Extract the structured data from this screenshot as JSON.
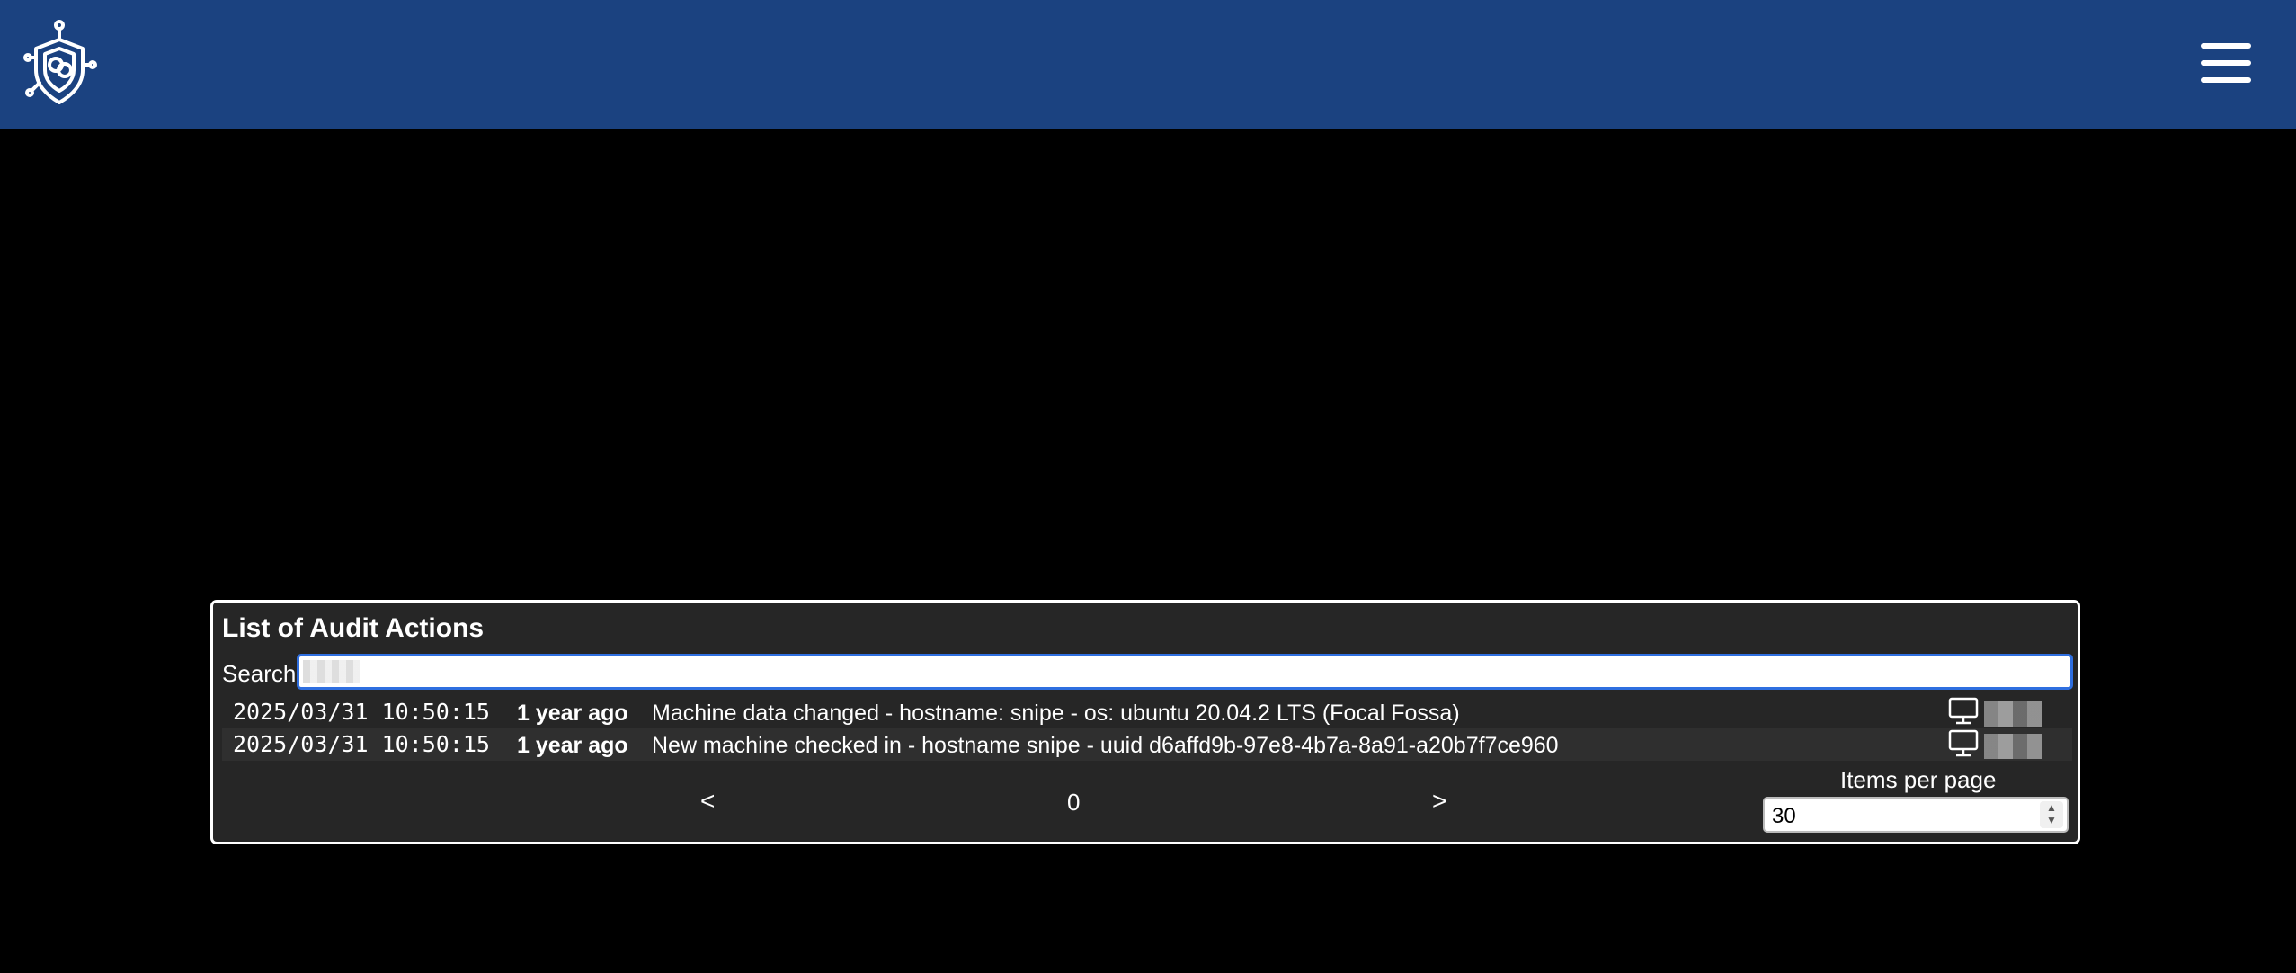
{
  "header": {
    "logo_icon": "shield-circuit-logo",
    "menu_icon": "hamburger-menu-icon",
    "background": "#1b4280"
  },
  "audit": {
    "title": "List of Audit Actions",
    "search_label": "Search",
    "search_value": "",
    "rows": [
      {
        "timestamp": "2025/03/31 10:50:15",
        "relative": "1 year ago",
        "message": "Machine data changed - hostname: snipe - os: ubuntu 20.04.2 LTS (Focal Fossa)",
        "icon": "computer-monitor-icon"
      },
      {
        "timestamp": "2025/03/31 10:50:15",
        "relative": "1 year ago",
        "message": "New machine checked in - hostname snipe - uuid d6affd9b-97e8-4b7a-8a91-a20b7f7ce960",
        "icon": "computer-monitor-icon"
      }
    ],
    "pager": {
      "prev": "<",
      "page": "0",
      "next": ">"
    },
    "items_per_page_label": "Items per page",
    "items_per_page": "30"
  }
}
